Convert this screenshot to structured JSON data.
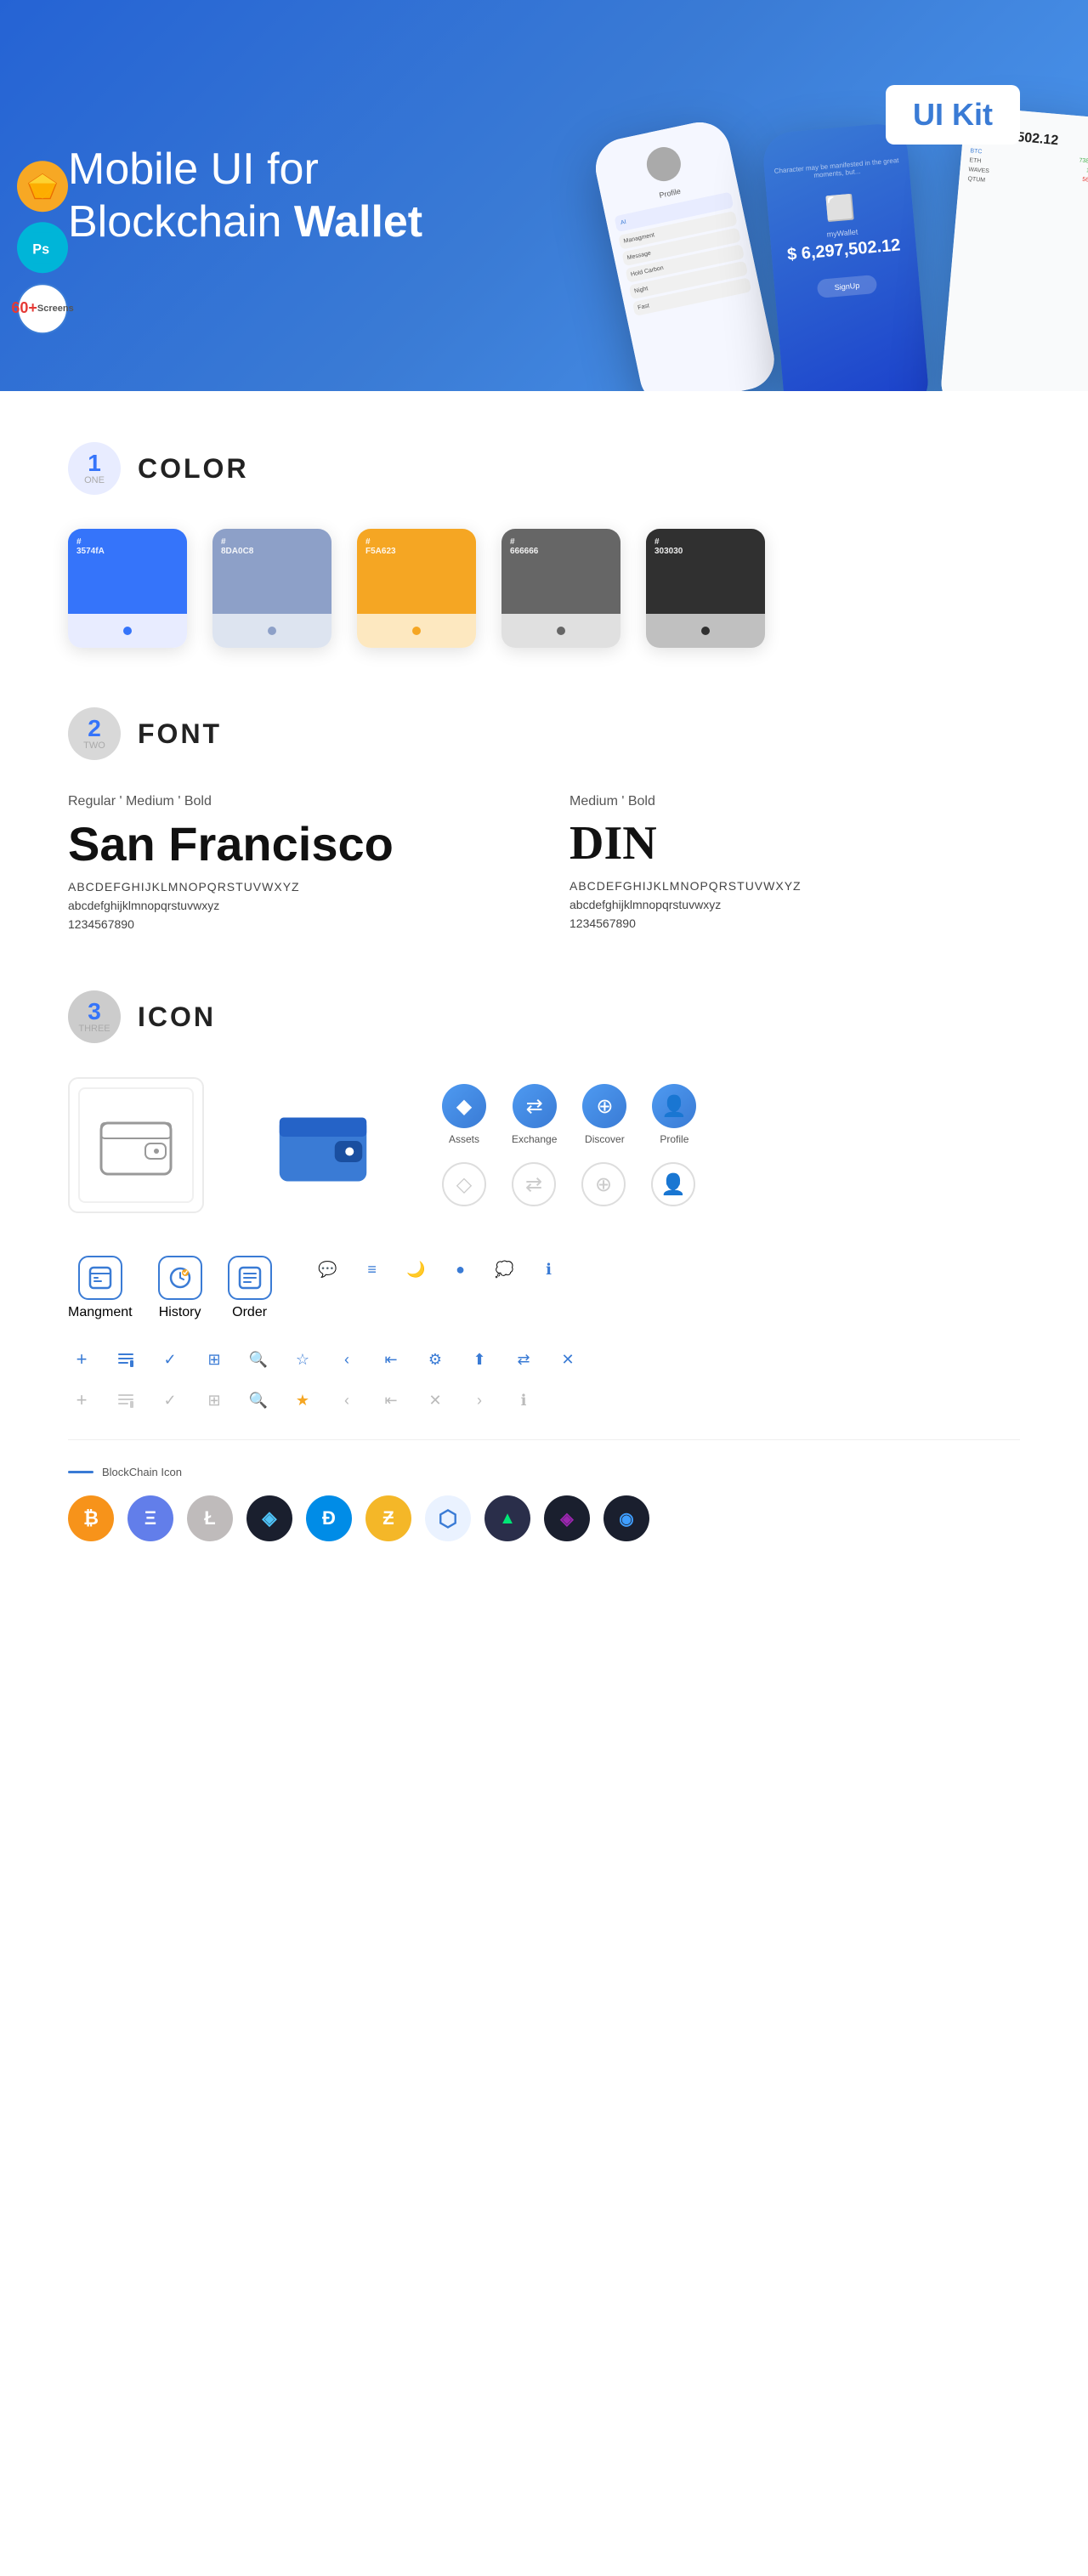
{
  "hero": {
    "title_part1": "Mobile UI for Blockchain ",
    "title_part2": "Wallet",
    "badge": "UI Kit",
    "sketch_label": "Sketch",
    "ps_label": "PS",
    "screens_count": "60+",
    "screens_label": "Screens"
  },
  "sections": {
    "color": {
      "number": "1",
      "word": "ONE",
      "title": "COLOR",
      "swatches": [
        {
          "hex": "#3574FA",
          "code": "#\n3574fA",
          "label": "Blue"
        },
        {
          "hex": "#8DA0C8",
          "code": "#\n8DA0C8",
          "label": "Slate"
        },
        {
          "hex": "#F5A623",
          "code": "#\nF5A623",
          "label": "Gold"
        },
        {
          "hex": "#666666",
          "code": "#\n666666",
          "label": "Gray"
        },
        {
          "hex": "#303030",
          "code": "#\n303030",
          "label": "Dark"
        }
      ]
    },
    "font": {
      "number": "2",
      "word": "TWO",
      "title": "FONT",
      "sf": {
        "weights": "Regular ' Medium ' Bold",
        "name": "San Francisco",
        "upper": "ABCDEFGHIJKLMNOPQRSTUVWXYZ",
        "lower": "abcdefghijklmnopqrstuvwxyz",
        "nums": "1234567890"
      },
      "din": {
        "weights": "Medium ' Bold",
        "name": "DIN",
        "upper": "ABCDEFGHIJKLMNOPQRSTUVWXYZ",
        "lower": "abcdefghijklmnopqrstuvwxyz",
        "nums": "1234567890"
      }
    },
    "icon": {
      "number": "3",
      "word": "THREE",
      "title": "ICON",
      "nav_items": [
        {
          "label": "Assets",
          "icon": "◆"
        },
        {
          "label": "Exchange",
          "icon": "⇄"
        },
        {
          "label": "Discover",
          "icon": "⊕"
        },
        {
          "label": "Profile",
          "icon": "⌀"
        }
      ],
      "app_icons": [
        {
          "label": "Mangment",
          "icon": "▣"
        },
        {
          "label": "History",
          "icon": "◷"
        },
        {
          "label": "Order",
          "icon": "≡"
        }
      ],
      "blockchain_label": "BlockChain Icon",
      "crypto_icons": [
        {
          "symbol": "₿",
          "color": "#f7931a"
        },
        {
          "symbol": "Ξ",
          "color": "#627eea"
        },
        {
          "symbol": "Ł",
          "color": "#bfbbbb"
        },
        {
          "symbol": "◈",
          "color": "#1a1f2e"
        },
        {
          "symbol": "Đ",
          "color": "#008ce7"
        },
        {
          "symbol": "Ƶ",
          "color": "#5a9e68"
        },
        {
          "symbol": "⬡",
          "color": "#5b9bd5"
        },
        {
          "symbol": "▲",
          "color": "#2a2e4a"
        },
        {
          "symbol": "◈",
          "color": "#f5c518"
        },
        {
          "symbol": "◉",
          "color": "#1a1f2e"
        }
      ]
    }
  }
}
